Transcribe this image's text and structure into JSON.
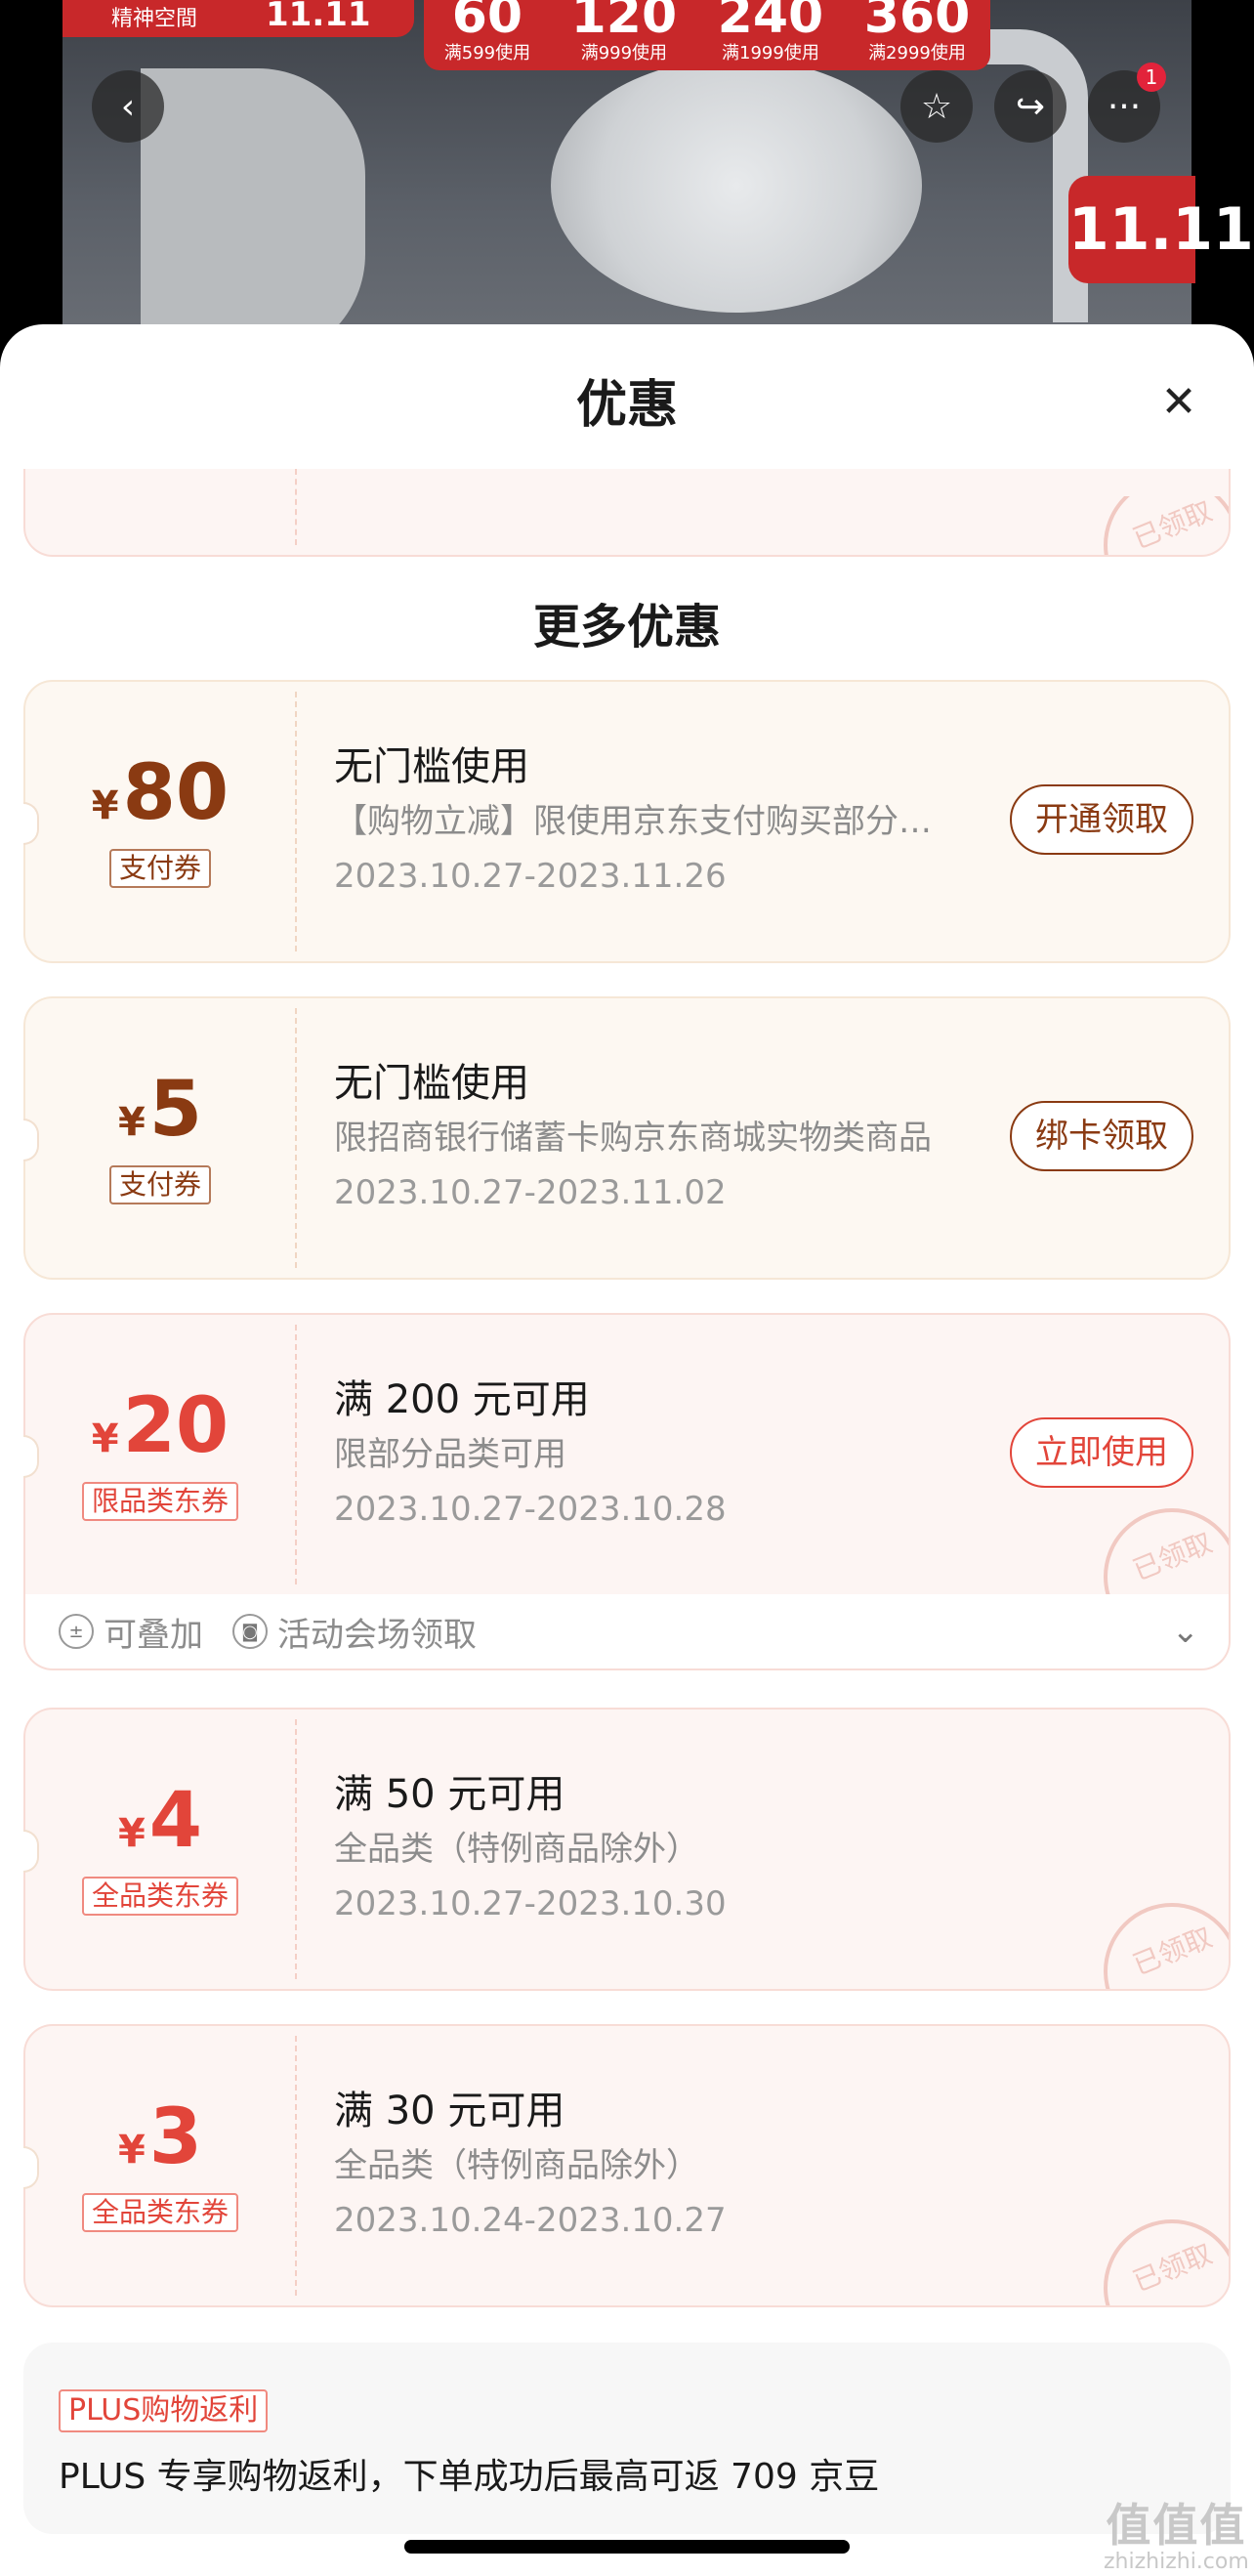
{
  "banner": {
    "promo_left_label": "精神空間",
    "promo_left_value": "11.11",
    "promo_tiers": [
      {
        "amount": "60",
        "condition": "满599使用"
      },
      {
        "amount": "120",
        "condition": "满999使用"
      },
      {
        "amount": "240",
        "condition": "满1999使用"
      },
      {
        "amount": "360",
        "condition": "满2999使用"
      }
    ],
    "badge_text": "11.11",
    "more_badge_count": "1"
  },
  "icons": {
    "back": "chevron-left-icon",
    "favorite": "star-icon",
    "share": "share-icon",
    "more": "more-icon",
    "close": "close-icon"
  },
  "sheet": {
    "title": "优惠",
    "stamp_text": "已领取",
    "more_section_title": "更多优惠"
  },
  "coupons": [
    {
      "yen": "¥",
      "amount": "80",
      "type_tag": "支付券",
      "title": "无门槛使用",
      "desc": "【购物立减】限使用京东支付购买部分商品",
      "validity": "2023.10.27-2023.11.26",
      "action": "开通领取"
    },
    {
      "yen": "¥",
      "amount": "5",
      "type_tag": "支付券",
      "title": "无门槛使用",
      "desc": "限招商银行储蓄卡购京东商城实物类商品",
      "validity": "2023.10.27-2023.11.02",
      "action": "绑卡领取"
    },
    {
      "yen": "¥",
      "amount": "20",
      "type_tag": "限品类东券",
      "title": "满 200 元可用",
      "desc": "限部分品类可用",
      "validity": "2023.10.27-2023.10.28",
      "action": "立即使用",
      "footer": {
        "stackable": "可叠加",
        "source": "活动会场领取"
      }
    },
    {
      "yen": "¥",
      "amount": "4",
      "type_tag": "全品类东券",
      "title": "满 50 元可用",
      "desc": "全品类（特例商品除外）",
      "validity": "2023.10.27-2023.10.30"
    },
    {
      "yen": "¥",
      "amount": "3",
      "type_tag": "全品类东券",
      "title": "满 30 元可用",
      "desc": "全品类（特例商品除外）",
      "validity": "2023.10.24-2023.10.27"
    }
  ],
  "plus": {
    "tag": "PLUS购物返利",
    "text": "PLUS 专享购物返利，下单成功后最高可返 709 京豆"
  },
  "watermark": {
    "big": "值值值",
    "small": "zhizhizhi.com"
  }
}
